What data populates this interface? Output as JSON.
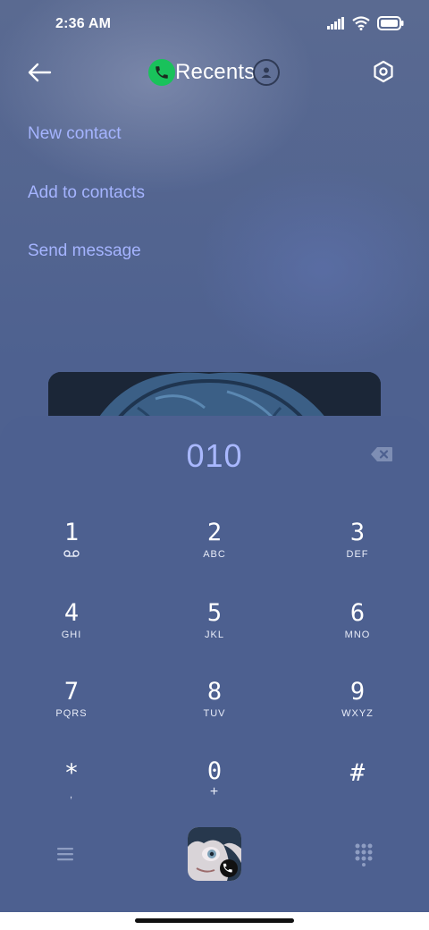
{
  "status_bar": {
    "time": "2:36 AM"
  },
  "header": {
    "title": "Recents"
  },
  "menu": {
    "items": [
      {
        "label": "New contact"
      },
      {
        "label": "Add to contacts"
      },
      {
        "label": "Send message"
      }
    ]
  },
  "dialer": {
    "number": "010",
    "keys": [
      {
        "digit": "1",
        "letters": ""
      },
      {
        "digit": "2",
        "letters": "ABC"
      },
      {
        "digit": "3",
        "letters": "DEF"
      },
      {
        "digit": "4",
        "letters": "GHI"
      },
      {
        "digit": "5",
        "letters": "JKL"
      },
      {
        "digit": "6",
        "letters": "MNO"
      },
      {
        "digit": "7",
        "letters": "PQRS"
      },
      {
        "digit": "8",
        "letters": "TUV"
      },
      {
        "digit": "9",
        "letters": "WXYZ"
      },
      {
        "digit": "*",
        "letters": ","
      },
      {
        "digit": "0",
        "letters": "+"
      },
      {
        "digit": "#",
        "letters": ""
      }
    ]
  },
  "icons": {
    "back": "arrow-left-icon",
    "phone": "phone-icon",
    "contacts": "person-icon",
    "settings": "hexagon-settings-icon",
    "backspace": "backspace-icon",
    "voicemail": "voicemail-icon",
    "menu": "hamburger-icon",
    "call": "call-avatar-icon",
    "dialpad": "dialpad-icon"
  },
  "colors": {
    "accent": "#a5b4ff",
    "phone_green": "#19c25b",
    "panel": "#4d6090"
  }
}
